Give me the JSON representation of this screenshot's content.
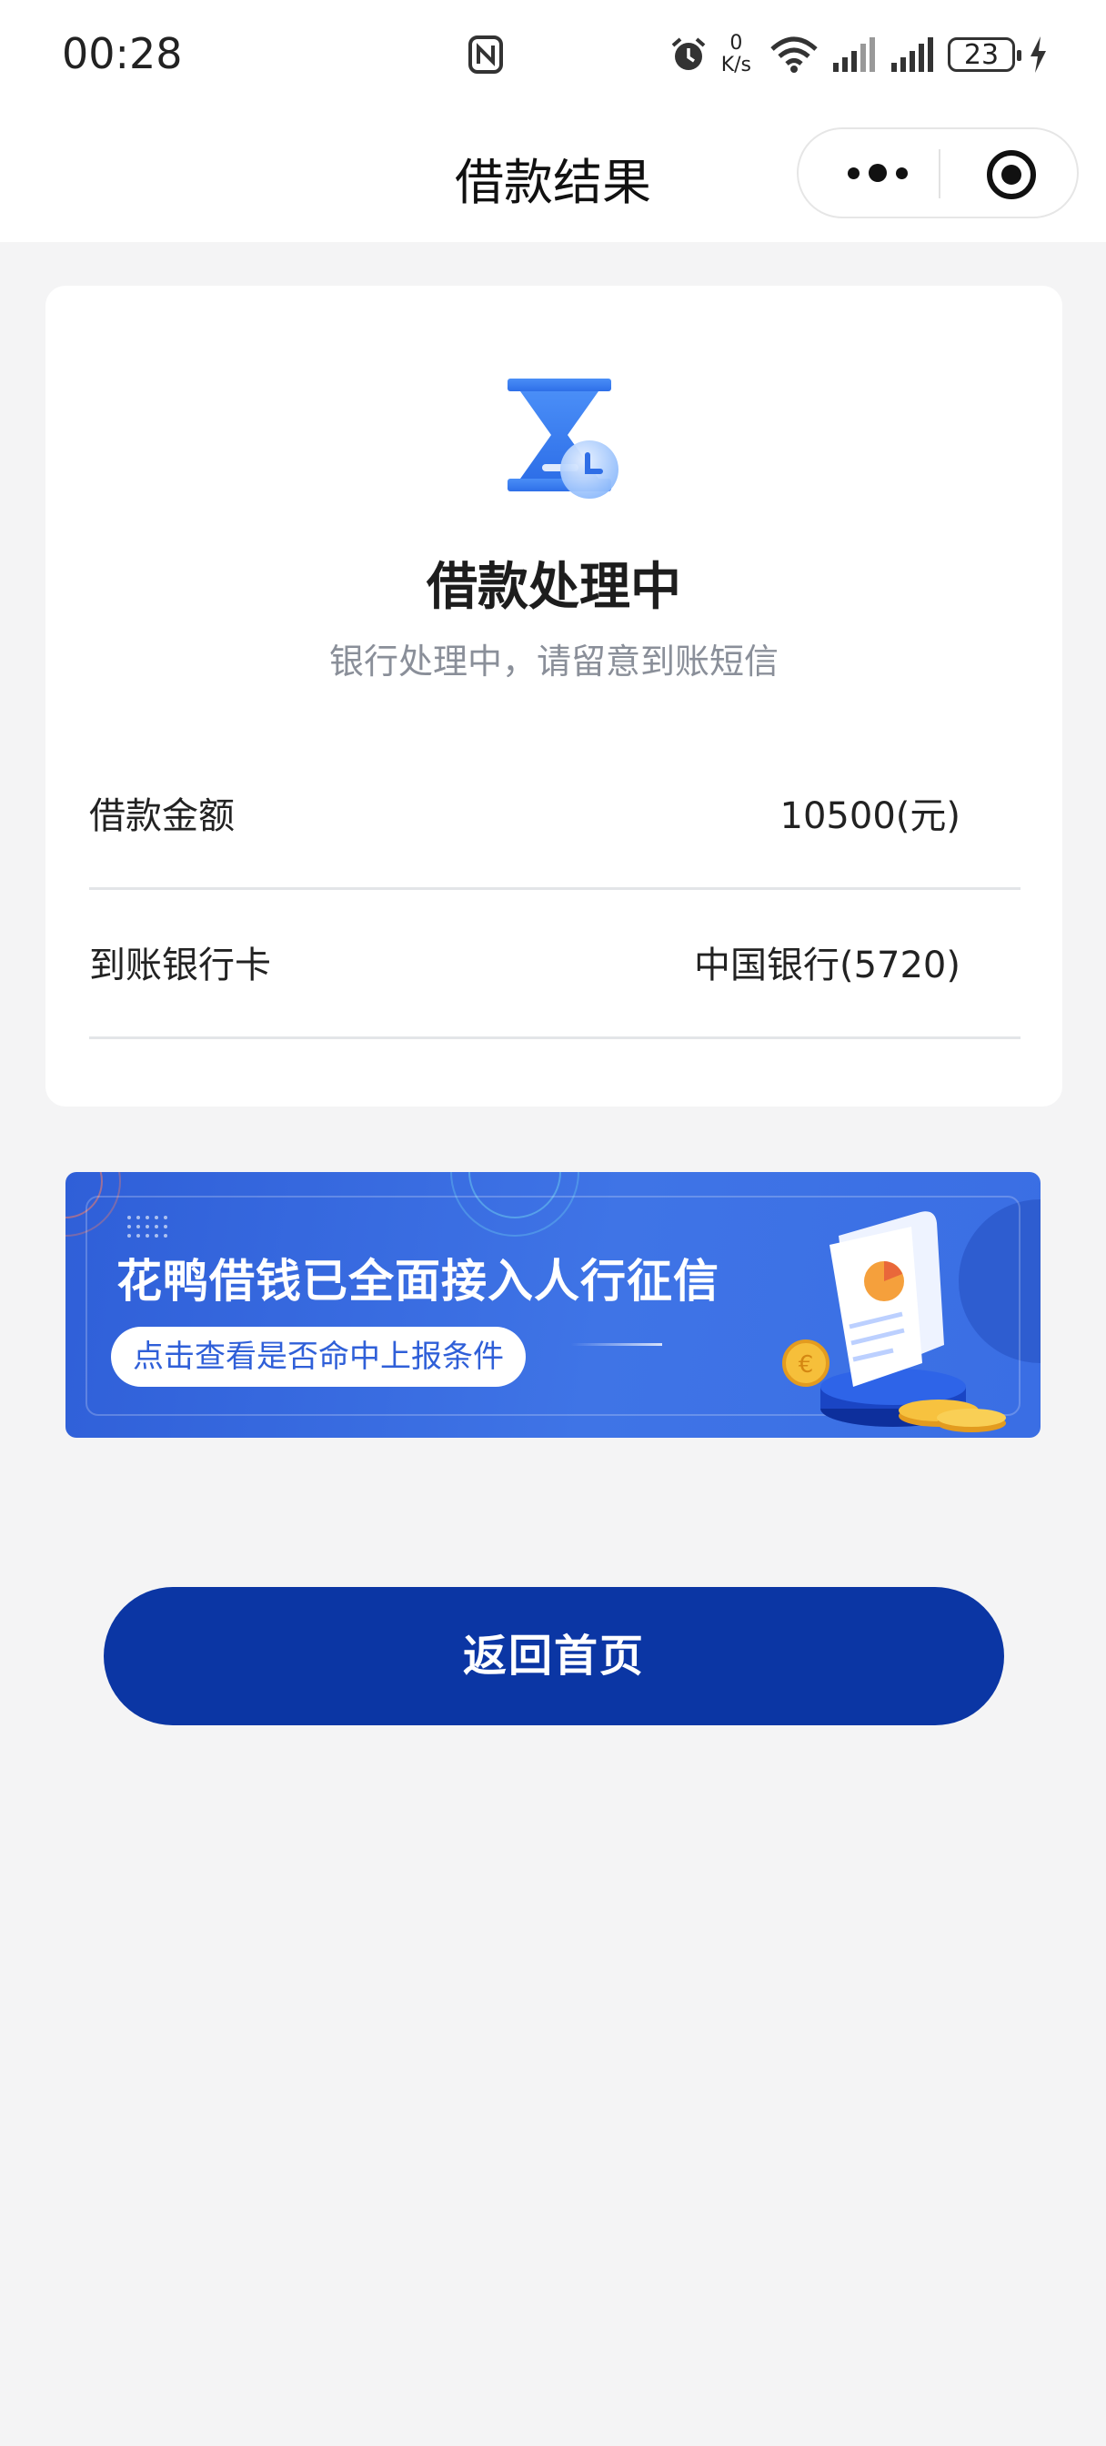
{
  "status_bar": {
    "time": "00:28",
    "speed_value": "0",
    "speed_unit": "K/s",
    "battery": "23",
    "icons": [
      "nfc-icon",
      "alarm-icon",
      "wifi-icon",
      "signal-icon",
      "signal-icon",
      "battery-icon",
      "charging-icon"
    ]
  },
  "navbar": {
    "title": "借款结果",
    "more_icon": "more-dots-icon",
    "close_icon": "target-close-icon"
  },
  "result": {
    "status_icon": "hourglass-clock-icon",
    "title": "借款处理中",
    "subtitle": "银行处理中，请留意到账短信",
    "rows": [
      {
        "label": "借款金额",
        "value": "10500(元)"
      },
      {
        "label": "到账银行卡",
        "value": "中国银行(5720)"
      }
    ]
  },
  "banner": {
    "title": "花鸭借钱已全面接入人行征信",
    "button_label": "点击查看是否命中上报条件",
    "art": "report-document-coins-illustration"
  },
  "actions": {
    "home_button": "返回首页"
  },
  "colors": {
    "primary": "#0b36a4",
    "banner": "#3a6ee4",
    "icon_blue": "#3b82f6",
    "page_bg": "#f4f4f5"
  }
}
